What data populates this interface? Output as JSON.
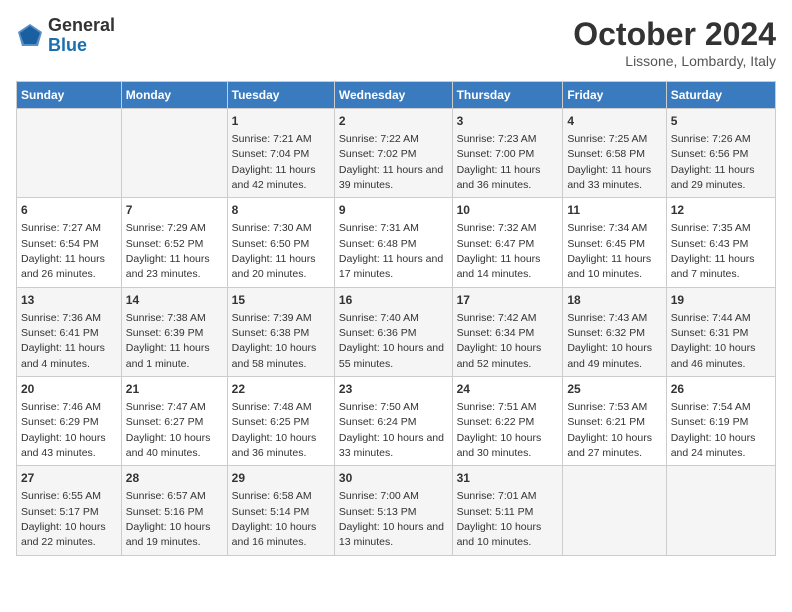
{
  "logo": {
    "general": "General",
    "blue": "Blue"
  },
  "title": "October 2024",
  "location": "Lissone, Lombardy, Italy",
  "weekdays": [
    "Sunday",
    "Monday",
    "Tuesday",
    "Wednesday",
    "Thursday",
    "Friday",
    "Saturday"
  ],
  "weeks": [
    [
      {
        "day": "",
        "sunrise": "",
        "sunset": "",
        "daylight": ""
      },
      {
        "day": "",
        "sunrise": "",
        "sunset": "",
        "daylight": ""
      },
      {
        "day": "1",
        "sunrise": "Sunrise: 7:21 AM",
        "sunset": "Sunset: 7:04 PM",
        "daylight": "Daylight: 11 hours and 42 minutes."
      },
      {
        "day": "2",
        "sunrise": "Sunrise: 7:22 AM",
        "sunset": "Sunset: 7:02 PM",
        "daylight": "Daylight: 11 hours and 39 minutes."
      },
      {
        "day": "3",
        "sunrise": "Sunrise: 7:23 AM",
        "sunset": "Sunset: 7:00 PM",
        "daylight": "Daylight: 11 hours and 36 minutes."
      },
      {
        "day": "4",
        "sunrise": "Sunrise: 7:25 AM",
        "sunset": "Sunset: 6:58 PM",
        "daylight": "Daylight: 11 hours and 33 minutes."
      },
      {
        "day": "5",
        "sunrise": "Sunrise: 7:26 AM",
        "sunset": "Sunset: 6:56 PM",
        "daylight": "Daylight: 11 hours and 29 minutes."
      }
    ],
    [
      {
        "day": "6",
        "sunrise": "Sunrise: 7:27 AM",
        "sunset": "Sunset: 6:54 PM",
        "daylight": "Daylight: 11 hours and 26 minutes."
      },
      {
        "day": "7",
        "sunrise": "Sunrise: 7:29 AM",
        "sunset": "Sunset: 6:52 PM",
        "daylight": "Daylight: 11 hours and 23 minutes."
      },
      {
        "day": "8",
        "sunrise": "Sunrise: 7:30 AM",
        "sunset": "Sunset: 6:50 PM",
        "daylight": "Daylight: 11 hours and 20 minutes."
      },
      {
        "day": "9",
        "sunrise": "Sunrise: 7:31 AM",
        "sunset": "Sunset: 6:48 PM",
        "daylight": "Daylight: 11 hours and 17 minutes."
      },
      {
        "day": "10",
        "sunrise": "Sunrise: 7:32 AM",
        "sunset": "Sunset: 6:47 PM",
        "daylight": "Daylight: 11 hours and 14 minutes."
      },
      {
        "day": "11",
        "sunrise": "Sunrise: 7:34 AM",
        "sunset": "Sunset: 6:45 PM",
        "daylight": "Daylight: 11 hours and 10 minutes."
      },
      {
        "day": "12",
        "sunrise": "Sunrise: 7:35 AM",
        "sunset": "Sunset: 6:43 PM",
        "daylight": "Daylight: 11 hours and 7 minutes."
      }
    ],
    [
      {
        "day": "13",
        "sunrise": "Sunrise: 7:36 AM",
        "sunset": "Sunset: 6:41 PM",
        "daylight": "Daylight: 11 hours and 4 minutes."
      },
      {
        "day": "14",
        "sunrise": "Sunrise: 7:38 AM",
        "sunset": "Sunset: 6:39 PM",
        "daylight": "Daylight: 11 hours and 1 minute."
      },
      {
        "day": "15",
        "sunrise": "Sunrise: 7:39 AM",
        "sunset": "Sunset: 6:38 PM",
        "daylight": "Daylight: 10 hours and 58 minutes."
      },
      {
        "day": "16",
        "sunrise": "Sunrise: 7:40 AM",
        "sunset": "Sunset: 6:36 PM",
        "daylight": "Daylight: 10 hours and 55 minutes."
      },
      {
        "day": "17",
        "sunrise": "Sunrise: 7:42 AM",
        "sunset": "Sunset: 6:34 PM",
        "daylight": "Daylight: 10 hours and 52 minutes."
      },
      {
        "day": "18",
        "sunrise": "Sunrise: 7:43 AM",
        "sunset": "Sunset: 6:32 PM",
        "daylight": "Daylight: 10 hours and 49 minutes."
      },
      {
        "day": "19",
        "sunrise": "Sunrise: 7:44 AM",
        "sunset": "Sunset: 6:31 PM",
        "daylight": "Daylight: 10 hours and 46 minutes."
      }
    ],
    [
      {
        "day": "20",
        "sunrise": "Sunrise: 7:46 AM",
        "sunset": "Sunset: 6:29 PM",
        "daylight": "Daylight: 10 hours and 43 minutes."
      },
      {
        "day": "21",
        "sunrise": "Sunrise: 7:47 AM",
        "sunset": "Sunset: 6:27 PM",
        "daylight": "Daylight: 10 hours and 40 minutes."
      },
      {
        "day": "22",
        "sunrise": "Sunrise: 7:48 AM",
        "sunset": "Sunset: 6:25 PM",
        "daylight": "Daylight: 10 hours and 36 minutes."
      },
      {
        "day": "23",
        "sunrise": "Sunrise: 7:50 AM",
        "sunset": "Sunset: 6:24 PM",
        "daylight": "Daylight: 10 hours and 33 minutes."
      },
      {
        "day": "24",
        "sunrise": "Sunrise: 7:51 AM",
        "sunset": "Sunset: 6:22 PM",
        "daylight": "Daylight: 10 hours and 30 minutes."
      },
      {
        "day": "25",
        "sunrise": "Sunrise: 7:53 AM",
        "sunset": "Sunset: 6:21 PM",
        "daylight": "Daylight: 10 hours and 27 minutes."
      },
      {
        "day": "26",
        "sunrise": "Sunrise: 7:54 AM",
        "sunset": "Sunset: 6:19 PM",
        "daylight": "Daylight: 10 hours and 24 minutes."
      }
    ],
    [
      {
        "day": "27",
        "sunrise": "Sunrise: 6:55 AM",
        "sunset": "Sunset: 5:17 PM",
        "daylight": "Daylight: 10 hours and 22 minutes."
      },
      {
        "day": "28",
        "sunrise": "Sunrise: 6:57 AM",
        "sunset": "Sunset: 5:16 PM",
        "daylight": "Daylight: 10 hours and 19 minutes."
      },
      {
        "day": "29",
        "sunrise": "Sunrise: 6:58 AM",
        "sunset": "Sunset: 5:14 PM",
        "daylight": "Daylight: 10 hours and 16 minutes."
      },
      {
        "day": "30",
        "sunrise": "Sunrise: 7:00 AM",
        "sunset": "Sunset: 5:13 PM",
        "daylight": "Daylight: 10 hours and 13 minutes."
      },
      {
        "day": "31",
        "sunrise": "Sunrise: 7:01 AM",
        "sunset": "Sunset: 5:11 PM",
        "daylight": "Daylight: 10 hours and 10 minutes."
      },
      {
        "day": "",
        "sunrise": "",
        "sunset": "",
        "daylight": ""
      },
      {
        "day": "",
        "sunrise": "",
        "sunset": "",
        "daylight": ""
      }
    ]
  ]
}
